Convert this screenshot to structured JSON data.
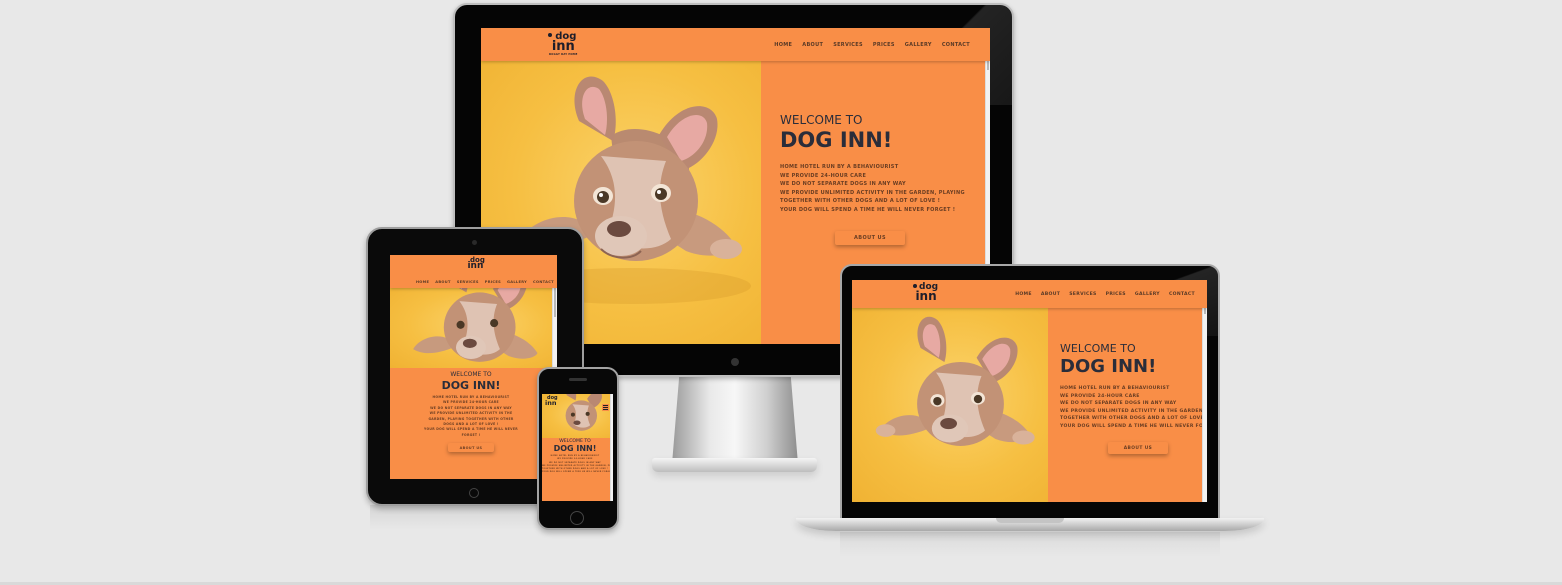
{
  "site": {
    "logo_word1": "dog",
    "logo_word2": "inn",
    "logo_tagline": "DOGGY DAY HOME",
    "nav": [
      "HOME",
      "ABOUT",
      "SERVICES",
      "PRICES",
      "GALLERY",
      "CONTACT"
    ],
    "welcome": "WELCOME TO",
    "brand": "DOG INN!",
    "lines": [
      "HOME HOTEL RUN BY A BEHAVIOURIST",
      "WE PROVIDE 24-HOUR CARE",
      "WE DO NOT SEPARATE DOGS IN ANY WAY",
      "WE PROVIDE UNLIMITED ACTIVITY IN THE GARDEN, PLAYING",
      "TOGETHER WITH OTHER DOGS AND A LOT OF LOVE !",
      "YOUR DOG WILL SPEND A TIME HE WILL NEVER FORGET !"
    ],
    "tablet_lines": [
      "HOME HOTEL RUN BY A BEHAVIOURIST",
      "WE PROVIDE 24-HOUR CARE",
      "WE DO NOT SEPARATE DOGS IN ANY WAY",
      "WE PROVIDE UNLIMITED ACTIVITY IN THE",
      "GARDEN, PLAYING TOGETHER WITH OTHER",
      "DOGS AND A LOT OF LOVE !",
      "YOUR DOG WILL SPEND A TIME HE WILL NEVER",
      "FORGET !"
    ],
    "about_button": "ABOUT US"
  },
  "colors": {
    "accent": "#f98e47",
    "hero_yellow": "#f6bf42",
    "heading": "#2a2d3a"
  },
  "icons": {
    "menu": "hamburger-menu-icon"
  }
}
